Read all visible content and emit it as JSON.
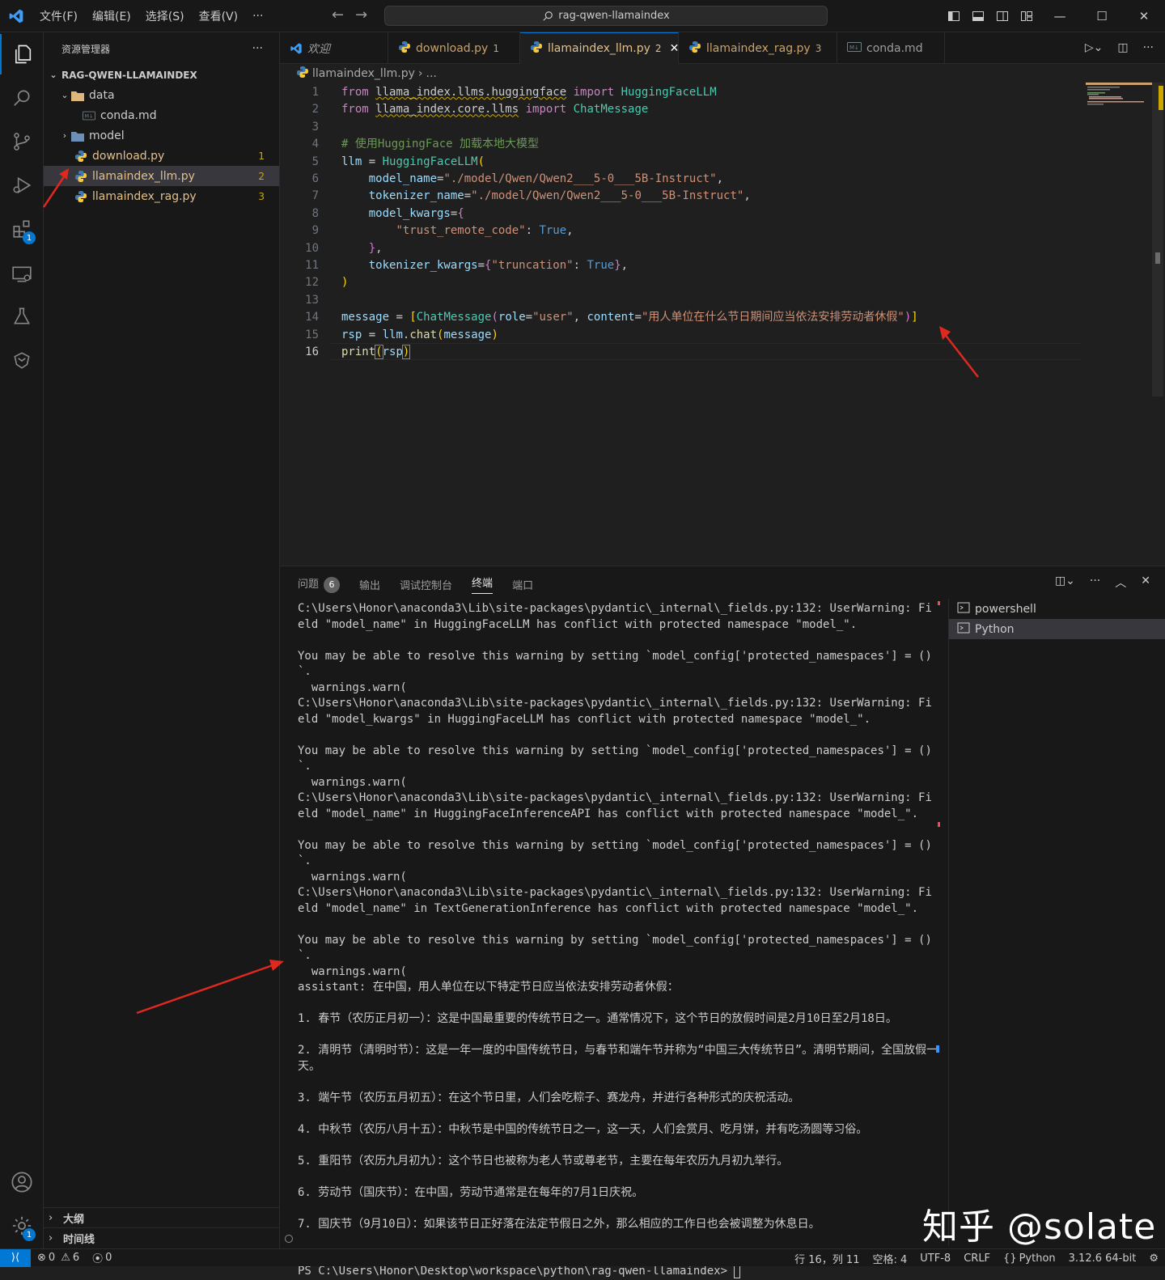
{
  "titlebar": {
    "menu": [
      "文件(F)",
      "编辑(E)",
      "选择(S)",
      "查看(V)",
      "···"
    ],
    "search": "rag-qwen-llamaindex"
  },
  "activity": {
    "extensions_badge": "1",
    "settings_badge": "1"
  },
  "sidebar": {
    "title": "资源管理器",
    "more": "···",
    "root": "RAG-QWEN-LLAMAINDEX",
    "items": [
      {
        "label": "data",
        "count": ""
      },
      {
        "label": "conda.md",
        "count": ""
      },
      {
        "label": "model",
        "count": ""
      },
      {
        "label": "download.py",
        "count": "1"
      },
      {
        "label": "llamaindex_llm.py",
        "count": "2"
      },
      {
        "label": "llamaindex_rag.py",
        "count": "3"
      }
    ],
    "outline": "大纲",
    "timeline": "时间线"
  },
  "tabs": [
    {
      "label": "欢迎",
      "num": ""
    },
    {
      "label": "download.py",
      "num": "1"
    },
    {
      "label": "llamaindex_llm.py",
      "num": "2"
    },
    {
      "label": "llamaindex_rag.py",
      "num": "3"
    },
    {
      "label": "conda.md",
      "num": ""
    }
  ],
  "breadcrumb": {
    "file": "llamaindex_llm.py",
    "rest": "..."
  },
  "editor": {
    "line_numbers": [
      "1",
      "2",
      "3",
      "4",
      "5",
      "6",
      "7",
      "8",
      "9",
      "10",
      "11",
      "12",
      "13",
      "14",
      "15",
      "16"
    ],
    "current_line": 16
  },
  "panel": {
    "tabs": [
      "问题",
      "输出",
      "调试控制台",
      "终端",
      "端口"
    ],
    "problems_count": "6",
    "terminals": [
      "powershell",
      "Python"
    ],
    "terminal_text": "C:\\Users\\Honor\\anaconda3\\Lib\\site-packages\\pydantic\\_internal\\_fields.py:132: UserWarning: Field \"model_name\" in HuggingFaceLLM has conflict with protected namespace \"model_\".\n\nYou may be able to resolve this warning by setting `model_config['protected_namespaces'] = ()`.\n  warnings.warn(\nC:\\Users\\Honor\\anaconda3\\Lib\\site-packages\\pydantic\\_internal\\_fields.py:132: UserWarning: Field \"model_kwargs\" in HuggingFaceLLM has conflict with protected namespace \"model_\".\n\nYou may be able to resolve this warning by setting `model_config['protected_namespaces'] = ()`.\n  warnings.warn(\nC:\\Users\\Honor\\anaconda3\\Lib\\site-packages\\pydantic\\_internal\\_fields.py:132: UserWarning: Field \"model_name\" in HuggingFaceInferenceAPI has conflict with protected namespace \"model_\".\n\nYou may be able to resolve this warning by setting `model_config['protected_namespaces'] = ()`.\n  warnings.warn(\nC:\\Users\\Honor\\anaconda3\\Lib\\site-packages\\pydantic\\_internal\\_fields.py:132: UserWarning: Field \"model_name\" in TextGenerationInference has conflict with protected namespace \"model_\".\n\nYou may be able to resolve this warning by setting `model_config['protected_namespaces'] = ()`.\n  warnings.warn(\nassistant: 在中国，用人单位在以下特定节日应当依法安排劳动者休假：\n\n1. 春节（农历正月初一）：这是中国最重要的传统节日之一。通常情况下，这个节日的放假时间是2月10日至2月18日。\n\n2. 清明节（清明时节）：这是一年一度的中国传统节日，与春节和端午节并称为“中国三大传统节日”。清明节期间，全国放假一天。\n\n3. 端午节（农历五月初五）：在这个节日里，人们会吃粽子、赛龙舟，并进行各种形式的庆祝活动。\n\n4. 中秋节（农历八月十五）：中秋节是中国的传统节日之一，这一天，人们会赏月、吃月饼，并有吃汤圆等习俗。\n\n5. 重阳节（农历九月初九）：这个节日也被称为老人节或尊老节，主要在每年农历九月初九举行。\n\n6. 劳动节（国庆节）：在中国，劳动节通常是在每年的7月1日庆祝。\n\n7. 国庆节（9月10日）：如果该节日正好落在法定节假日之外，那么相应的工作日也会被调整为休息日。\n\n需要注意的是，",
    "prompt": "PS C:\\Users\\Honor\\Desktop\\workspace\\python\\rag-qwen-llamaindex> "
  },
  "statusbar": {
    "errors": "0",
    "warnings": "6",
    "ports": "0",
    "position": "行 16，列 11",
    "spaces": "空格: 4",
    "encoding": "UTF-8",
    "eol": "CRLF",
    "language": "Python",
    "interpreter": "3.12.6 64-bit"
  },
  "watermark": "知乎 @solate",
  "colors": {
    "accent": "#0078d4",
    "modified": "#e2c08d",
    "arrow": "#e0281e"
  }
}
